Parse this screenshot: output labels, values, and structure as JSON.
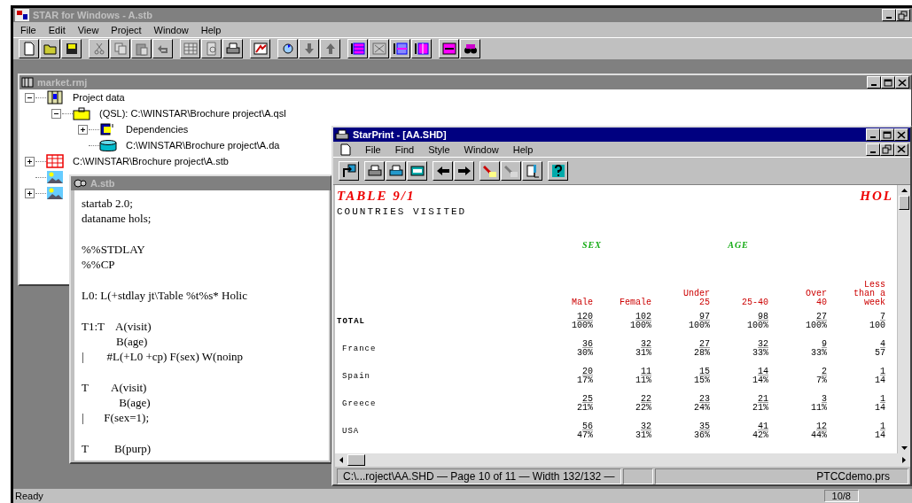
{
  "app": {
    "title": "STAR for Windows - A.stb",
    "active": false,
    "controls": [
      {
        "kind": "minimize"
      },
      {
        "kind": "restore"
      }
    ],
    "menu": [
      "File",
      "Edit",
      "View",
      "Project",
      "Window",
      "Help"
    ],
    "toolbar": [
      [
        {
          "kind": "page",
          "disabled": false
        },
        {
          "kind": "folder",
          "disabled": false
        },
        {
          "kind": "disk",
          "disabled": false
        }
      ],
      [
        {
          "kind": "scissors",
          "disabled": true
        },
        {
          "kind": "copy",
          "disabled": true
        },
        {
          "kind": "paste",
          "disabled": true
        },
        {
          "kind": "undo",
          "disabled": true
        }
      ],
      [
        {
          "kind": "table",
          "disabled": true
        },
        {
          "kind": "preview",
          "disabled": true
        },
        {
          "kind": "printer",
          "disabled": false
        }
      ],
      [
        {
          "kind": "chart",
          "disabled": false
        }
      ],
      [
        {
          "kind": "cycle",
          "disabled": false
        },
        {
          "kind": "down",
          "disabled": true
        },
        {
          "kind": "up",
          "disabled": true
        }
      ],
      [
        {
          "kind": "gridrows",
          "disabled": false
        },
        {
          "kind": "gridx",
          "disabled": true
        },
        {
          "kind": "gridbar",
          "disabled": false
        },
        {
          "kind": "gridbar2",
          "disabled": false
        }
      ],
      [
        {
          "kind": "gridswap",
          "disabled": false
        },
        {
          "kind": "binoculars",
          "disabled": false
        }
      ]
    ],
    "status": [
      "Ready",
      "10/8"
    ]
  },
  "project_window": {
    "title": "market.rmj",
    "active": false,
    "controls": [
      {
        "kind": "minimize"
      },
      {
        "kind": "maximize"
      },
      {
        "kind": "close"
      }
    ],
    "tree": [
      {
        "label": "Project data",
        "kind": "project",
        "expanded": true,
        "children": [
          {
            "label": "(QSL): C:\\WINSTAR\\Brochure project\\A.qsl",
            "kind": "query",
            "expanded": true,
            "children": [
              {
                "label": "Dependencies",
                "kind": "dependencies",
                "expanded": false
              },
              {
                "label": "C:\\WINSTAR\\Brochure project\\A.da",
                "kind": "database"
              }
            ]
          }
        ]
      },
      {
        "label": "C:\\WINSTAR\\Brochure project\\A.stb",
        "kind": "table",
        "expanded": false
      },
      {
        "kind": "image"
      },
      {
        "kind": "image",
        "expanded": false
      }
    ]
  },
  "script_window": {
    "title": "A.stb",
    "active": false,
    "blocks": [
      [
        "startab 2.0;",
        "dataname hols;"
      ],
      [
        "%%STDLAY",
        "%%CP"
      ],
      [
        "L0: L(+stdlay jt\\Table %t%s* Holic"
      ],
      [
        "T1:T    A(visit)",
        "            B(age)",
        "|        #L(+L0 +cp) F(sex) W(noinp"
      ],
      [
        "T        A(visit)",
        "             B(age)",
        "|       F(sex=1);"
      ],
      [
        "T         B(purp)"
      ]
    ]
  },
  "print_window": {
    "title": "StarPrint - [AA.SHD]",
    "active": true,
    "controls": [
      {
        "kind": "minimize"
      },
      {
        "kind": "maximize"
      },
      {
        "kind": "close"
      }
    ],
    "doc_controls": [
      {
        "kind": "minimize"
      },
      {
        "kind": "restore"
      },
      {
        "kind": "close"
      }
    ],
    "menu": [
      "File",
      "Find",
      "Style",
      "Window",
      "Help"
    ],
    "toolbar": [
      [
        {
          "kind": "export",
          "disabled": false
        }
      ],
      [
        {
          "kind": "printer",
          "disabled": false
        },
        {
          "kind": "printer2",
          "disabled": false
        },
        {
          "kind": "view",
          "disabled": false
        }
      ],
      [
        {
          "kind": "left",
          "disabled": false
        },
        {
          "kind": "right",
          "disabled": false
        }
      ],
      [
        {
          "kind": "brush",
          "disabled": false
        },
        {
          "kind": "brush",
          "disabled": true
        },
        {
          "kind": "column",
          "disabled": false
        }
      ],
      [
        {
          "kind": "help",
          "disabled": false
        }
      ]
    ],
    "report": {
      "title": "TABLE 9/1",
      "title_right": "HOL",
      "subtitle": "COUNTRIES VISITED",
      "banners": [
        {
          "label": "SEX",
          "columns": [
            [
              "Male"
            ],
            [
              "Female"
            ]
          ]
        },
        {
          "label": "AGE",
          "columns": [
            [
              "Under",
              "25"
            ],
            [
              "25-40"
            ],
            [
              "Over",
              "40"
            ]
          ]
        },
        {
          "columns": [
            [
              "Less",
              "than a",
              "week"
            ]
          ]
        }
      ],
      "rows": [
        {
          "label": "TOTAL",
          "kind": "total",
          "cells": [
            [
              "120",
              "100%"
            ],
            [
              "102",
              "100%"
            ],
            [
              "97",
              "100%"
            ],
            [
              "98",
              "100%"
            ],
            [
              "27",
              "100%"
            ],
            [
              "7",
              "100"
            ]
          ]
        },
        {
          "label": "France",
          "kind": "item",
          "cells": [
            [
              "36",
              "30%"
            ],
            [
              "32",
              "31%"
            ],
            [
              "27",
              "28%"
            ],
            [
              "32",
              "33%"
            ],
            [
              "9",
              "33%"
            ],
            [
              "4",
              "57"
            ]
          ]
        },
        {
          "label": "Spain",
          "kind": "item",
          "cells": [
            [
              "20",
              "17%"
            ],
            [
              "11",
              "11%"
            ],
            [
              "15",
              "15%"
            ],
            [
              "14",
              "14%"
            ],
            [
              "2",
              "7%"
            ],
            [
              "1",
              "14"
            ]
          ]
        },
        {
          "label": "Greece",
          "kind": "item",
          "cells": [
            [
              "25",
              "21%"
            ],
            [
              "22",
              "22%"
            ],
            [
              "23",
              "24%"
            ],
            [
              "21",
              "21%"
            ],
            [
              "3",
              "11%"
            ],
            [
              "1",
              "14"
            ]
          ]
        },
        {
          "label": "USA",
          "kind": "item",
          "cells": [
            [
              "56",
              "47%"
            ],
            [
              "32",
              "31%"
            ],
            [
              "35",
              "36%"
            ],
            [
              "41",
              "42%"
            ],
            [
              "12",
              "44%"
            ],
            [
              "1",
              "14"
            ]
          ]
        }
      ]
    },
    "status": [
      "C:\\...roject\\AA.SHD  —  Page 10 of 11  —  Width 132/132  —",
      "PTCCdemo.prs"
    ]
  }
}
